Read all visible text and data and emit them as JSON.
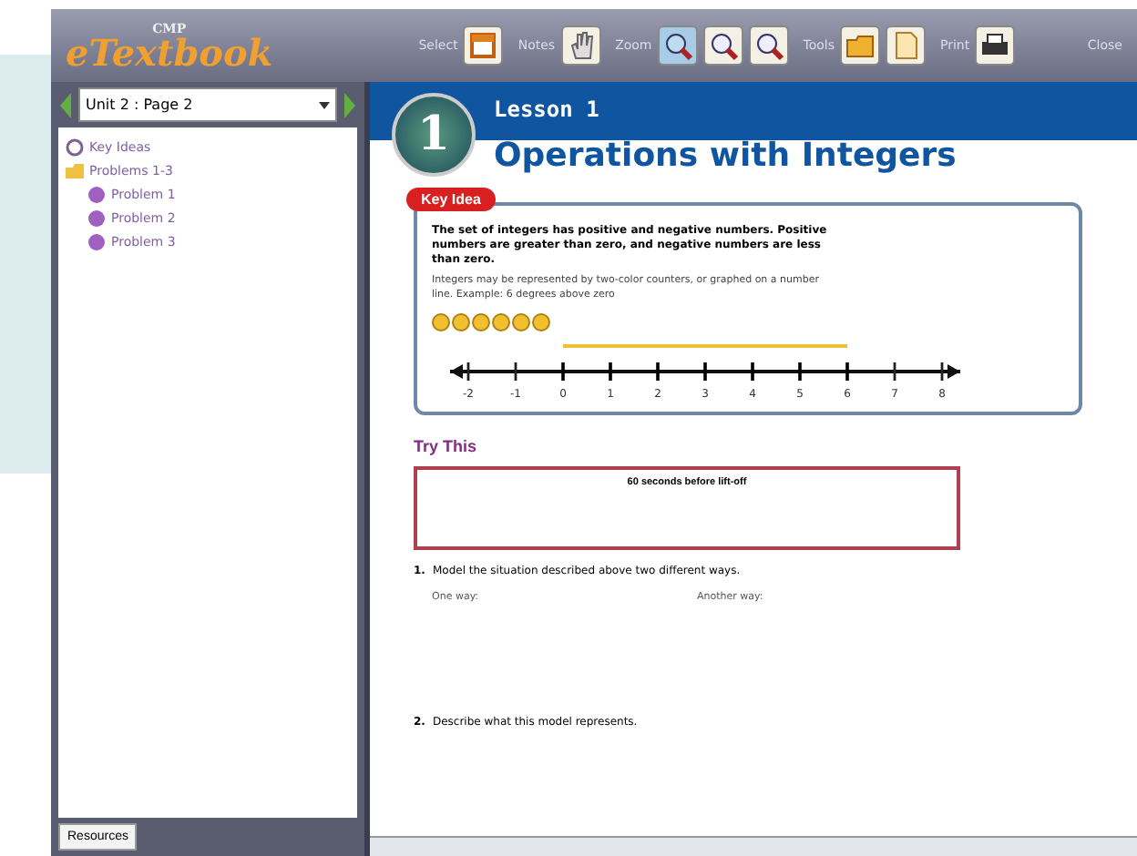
{
  "app": {
    "logo": "eTextbook",
    "logo_tag": "CMP"
  },
  "toolbar": {
    "groups": [
      {
        "label": "Select",
        "icons": [
          {
            "kind": "window",
            "selected": false
          }
        ]
      },
      {
        "label": "Notes",
        "icons": [
          {
            "kind": "hand",
            "selected": false
          }
        ]
      },
      {
        "label": "Zoom",
        "icons": [
          {
            "kind": "zoom-fit",
            "selected": true
          },
          {
            "kind": "zoom-in",
            "selected": false
          },
          {
            "kind": "zoom-out",
            "selected": false
          }
        ]
      },
      {
        "label": "Tools",
        "icons": [
          {
            "kind": "folder",
            "selected": false
          },
          {
            "kind": "page",
            "selected": false
          }
        ]
      },
      {
        "label": "Print",
        "icons": [
          {
            "kind": "printer",
            "selected": false
          }
        ]
      }
    ],
    "right_label": "Close"
  },
  "sidebar": {
    "page_select": {
      "value": "Unit 2 : Page 2"
    },
    "tree": [
      {
        "label": "Key Ideas",
        "kind": "key"
      },
      {
        "label": "Problems 1-3",
        "kind": "folder",
        "expanded": true,
        "children": [
          {
            "label": "Problem 1",
            "kind": "problem"
          },
          {
            "label": "Problem 2",
            "kind": "problem"
          },
          {
            "label": "Problem 3",
            "kind": "problem"
          }
        ]
      }
    ],
    "resources_button": "Resources"
  },
  "page": {
    "badge_number": "1",
    "lesson": "Lesson 1",
    "title": "Operations with Integers",
    "key_idea": {
      "tag": "Key Idea",
      "bold_text": "The set of integers has positive and negative numbers. Positive numbers are greater than zero, and negative numbers are less than zero.",
      "text": "Integers may be represented by two-color counters, or graphed on a number line. Example: 6 degrees above zero",
      "counters": [
        {
          "kind": "positive"
        },
        {
          "kind": "positive"
        },
        {
          "kind": "positive"
        },
        {
          "kind": "positive"
        },
        {
          "kind": "positive"
        },
        {
          "kind": "positive"
        }
      ],
      "number_line": [
        {
          "label": "-2",
          "highlighted": false
        },
        {
          "label": "-1",
          "highlighted": false
        },
        {
          "label": "0",
          "highlighted": true
        },
        {
          "label": "1",
          "highlighted": true
        },
        {
          "label": "2",
          "highlighted": true
        },
        {
          "label": "3",
          "highlighted": true
        },
        {
          "label": "4",
          "highlighted": true
        },
        {
          "label": "5",
          "highlighted": true
        },
        {
          "label": "6",
          "highlighted": true
        },
        {
          "label": "7",
          "highlighted": false
        },
        {
          "label": "8",
          "highlighted": false
        }
      ]
    },
    "try_this": {
      "heading": "Try This",
      "box_text": "60 seconds before lift-off"
    },
    "questions": [
      {
        "number": "1.",
        "text": "Model the situation described above two different ways.",
        "answers": [
          "One way:",
          "Another way:"
        ]
      },
      {
        "number": "2.",
        "text": "Describe what this model represents."
      }
    ]
  }
}
